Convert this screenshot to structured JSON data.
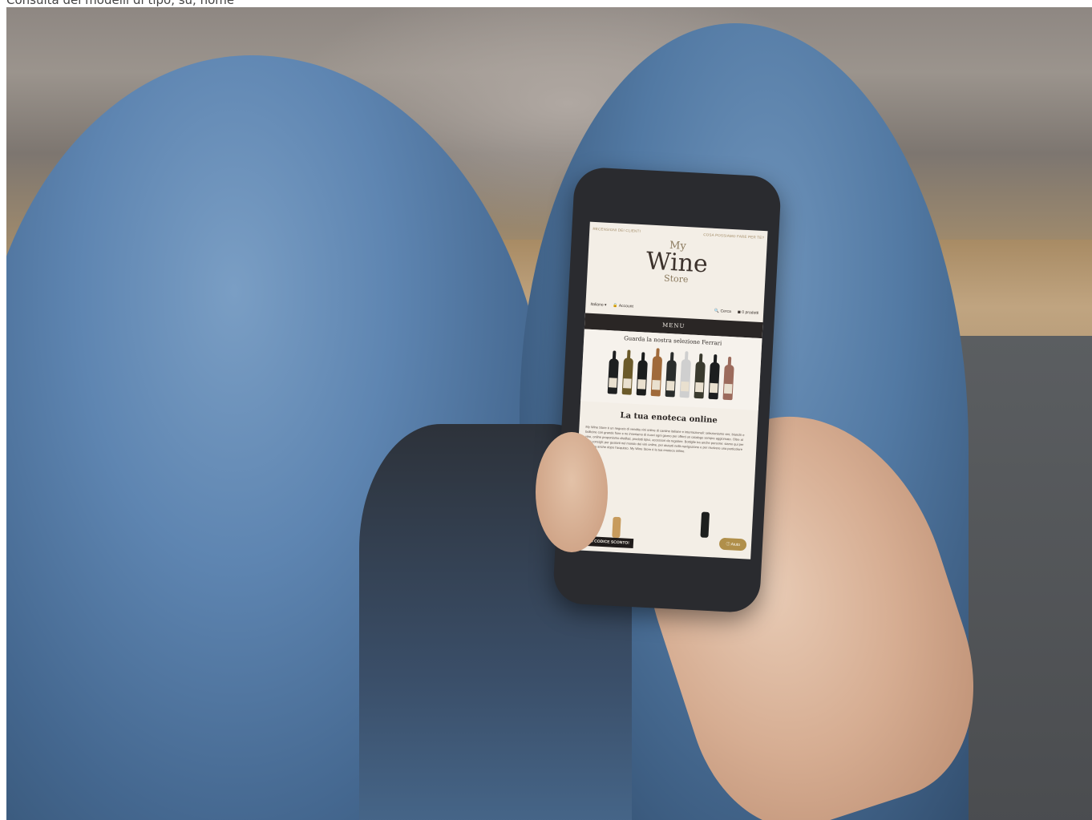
{
  "caption": {
    "text": "Consulta dei modelli di tipo, su, home"
  },
  "screen": {
    "topbar": {
      "left": "RECENSIONI DEI CLIENTI",
      "right": "COSA POSSIAMO FARE PER TE?"
    },
    "logo": {
      "my": "My",
      "wine": "Wine",
      "store": "Store"
    },
    "nav": {
      "language": "Italiano ▾",
      "account": "🔒 Account",
      "search": "🔍 Cerca",
      "cart": "◼ 0 prodotti"
    },
    "menu_label": "MENU",
    "banner_title": "Guarda la nostra selezione Ferrari",
    "heading": "La tua enoteca online",
    "body": "My Wine Store è un negozio di vendita vini online di cantine italiane e internazionali: selezioniamo vini, bianchi e bollicine con grande fiore e ne inseriamo di nuovi ogni giorno per offrirti un catalogo sempre aggiornato. Oltre al vino, online proponiamo distillati, prodotti tipici, accessori da regalare. Bottiglie tra anche persone: siamo qui per darti consigli; per gustarti nel mondo dei vini online, per aiutarti nella navigazione e per risolvere una particolare richiesta anche dopo l'acquisto. My Wine Store è la tua enoteca online.",
    "promo": "OTTIENI CODICE SCONTO!",
    "help": "ⓘ Aiuto"
  },
  "bottle_colors": [
    "#1e2021",
    "#6b5a2a",
    "#1b1d1c",
    "#a06a3a",
    "#2a2d2c",
    "#cfcfcf",
    "#3a3a2e",
    "#1c1e1f",
    "#9c6b5c"
  ]
}
